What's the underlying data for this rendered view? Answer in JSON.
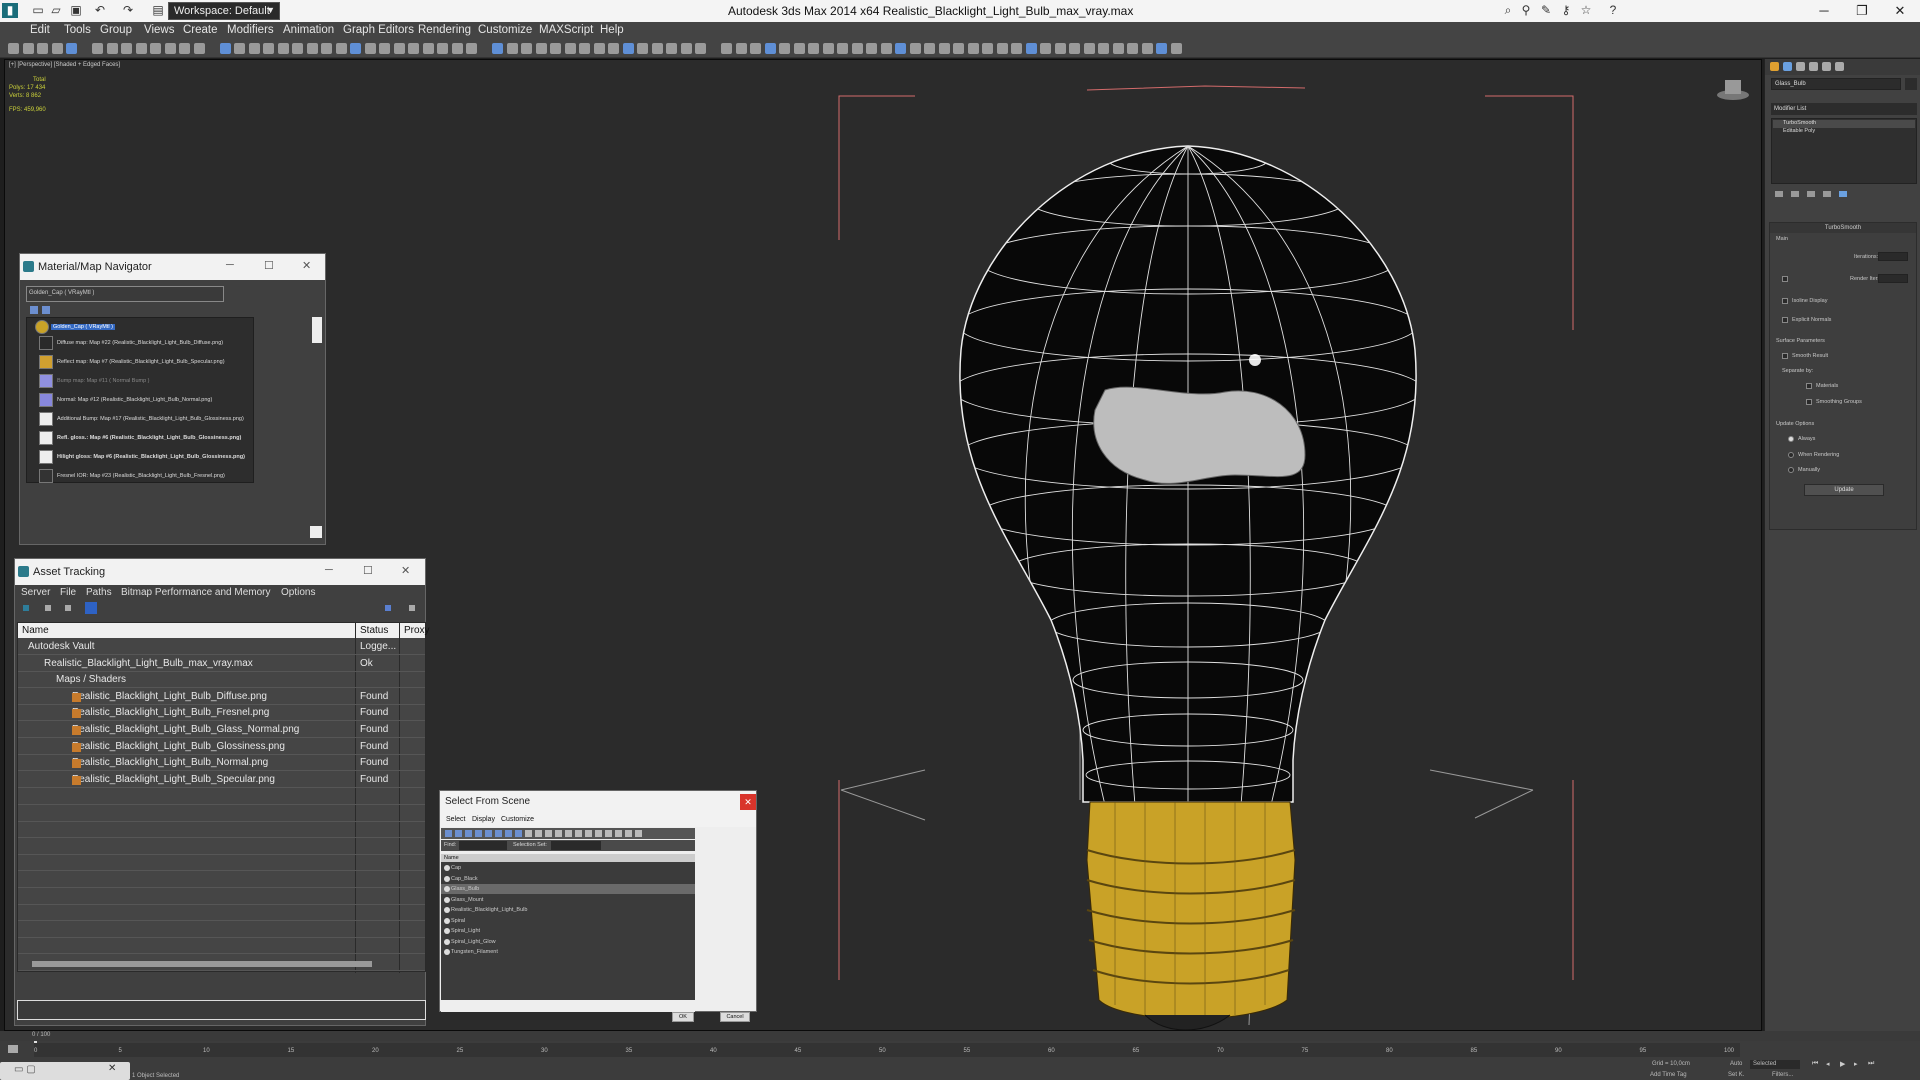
{
  "app": {
    "title": "Autodesk 3ds Max  2014 x64     Realistic_Blacklight_Light_Bulb_max_vray.max",
    "workspace": "Workspace: Default"
  },
  "menu": [
    "Edit",
    "Tools",
    "Group",
    "Views",
    "Create",
    "Modifiers",
    "Animation",
    "Graph Editors",
    "Rendering",
    "Customize",
    "MAXScript",
    "Help"
  ],
  "viewport": {
    "label": "[+] [Perspective] [Shaded + Edged Faces]",
    "stats": {
      "total": "Total",
      "polys_label": "Polys:",
      "polys": "17 434",
      "verts_label": "Verts:",
      "verts": "8 862",
      "fps_label": "FPS:",
      "fps": "459,960"
    }
  },
  "material_navigator": {
    "title": "Material/Map Navigator",
    "search": "Golden_Cap  ( VRayMtl )",
    "root": "Golden_Cap  ( VRayMtl )",
    "items": [
      {
        "label": "Diffuse map: Map #22 (Realistic_Blacklight_Light_Bulb_Diffuse.png)",
        "color": "#2a2a2a"
      },
      {
        "label": "Reflect map: Map #7 (Realistic_Blacklight_Light_Bulb_Specular.png)",
        "color": "#d0a030"
      },
      {
        "label": "Bump map: Map #11 ( Normal Bump )",
        "color": "#9090e0"
      },
      {
        "label": "Normal: Map #12 (Realistic_Blacklight_Light_Bulb_Normal.png)",
        "color": "#8888dd"
      },
      {
        "label": "Additional Bump: Map #17 (Realistic_Blacklight_Light_Bulb_Glossiness.png)",
        "color": "#eeeeee"
      },
      {
        "label": "Refl. gloss.: Map #6 (Realistic_Blacklight_Light_Bulb_Glossiness.png)",
        "color": "#eeeeee"
      },
      {
        "label": "Hilight gloss: Map #6 (Realistic_Blacklight_Light_Bulb_Glossiness.png)",
        "color": "#eeeeee"
      },
      {
        "label": "Fresnel IOR: Map #23 (Realistic_Blacklight_Light_Bulb_Fresnel.png)",
        "color": "#333333"
      }
    ]
  },
  "asset_tracking": {
    "title": "Asset Tracking",
    "menu": [
      "Server",
      "File",
      "Paths",
      "Bitmap Performance and Memory",
      "Options"
    ],
    "columns": {
      "name": "Name",
      "status": "Status",
      "proxy": "Proxy"
    },
    "rows": [
      {
        "name": "Autodesk Vault",
        "status": "Logge..."
      },
      {
        "name": "Realistic_Blacklight_Light_Bulb_max_vray.max",
        "status": "Ok"
      },
      {
        "name": "Maps / Shaders",
        "status": ""
      },
      {
        "name": "Realistic_Blacklight_Light_Bulb_Diffuse.png",
        "status": "Found"
      },
      {
        "name": "Realistic_Blacklight_Light_Bulb_Fresnel.png",
        "status": "Found"
      },
      {
        "name": "Realistic_Blacklight_Light_Bulb_Glass_Normal.png",
        "status": "Found"
      },
      {
        "name": "Realistic_Blacklight_Light_Bulb_Glossiness.png",
        "status": "Found"
      },
      {
        "name": "Realistic_Blacklight_Light_Bulb_Normal.png",
        "status": "Found"
      },
      {
        "name": "Realistic_Blacklight_Light_Bulb_Specular.png",
        "status": "Found"
      }
    ]
  },
  "select_from_scene": {
    "title": "Select From Scene",
    "menu": [
      "Select",
      "Display",
      "Customize"
    ],
    "find_label": "Find:",
    "selection_set": "Selection Set:",
    "col_name": "Name",
    "items": [
      "Cap",
      "Cap_Black",
      "Glass_Bulb",
      "Glass_Mount",
      "Realistic_Blacklight_Light_Bulb",
      "Spiral",
      "Spiral_Light",
      "Spiral_Light_Glow",
      "Tungsten_Filament"
    ],
    "selected": "Glass_Bulb",
    "ok": "OK",
    "cancel": "Cancel"
  },
  "command_panel": {
    "object_name": "Glass_Bulb",
    "modifier_list": "Modifier List",
    "stack": [
      "TurboSmooth",
      "Editable Poly"
    ],
    "rollout": "TurboSmooth",
    "main": "Main",
    "iterations": "Iterations:",
    "render_iters": "Render Iters:",
    "isoline": "Isoline Display",
    "explicit": "Explicit Normals",
    "surface": "Surface Parameters",
    "smooth_result": "Smooth Result",
    "separate": "Separate by:",
    "materials": "Materials",
    "smoothing": "Smoothing Groups",
    "update_opts": "Update Options",
    "always": "Always",
    "when_rendering": "When Rendering",
    "manually": "Manually",
    "update": "Update"
  },
  "timeline": {
    "frame": "0 / 100",
    "ticks": [
      "0",
      "5",
      "10",
      "15",
      "20",
      "25",
      "30",
      "35",
      "40",
      "45",
      "50",
      "55",
      "60",
      "65",
      "70",
      "75",
      "80",
      "85",
      "90",
      "95",
      "100"
    ],
    "status": "1 Object Selected",
    "selected": "Selected",
    "grid": "Grid = 10,0cm",
    "auto": "Auto",
    "setk": "Set K.",
    "filters": "Filters...",
    "add_time_tag": "Add Time Tag"
  },
  "colors": {
    "cap": "#c9a227",
    "viewport": "#2b2b2b",
    "wire": "#e8e8e8"
  }
}
